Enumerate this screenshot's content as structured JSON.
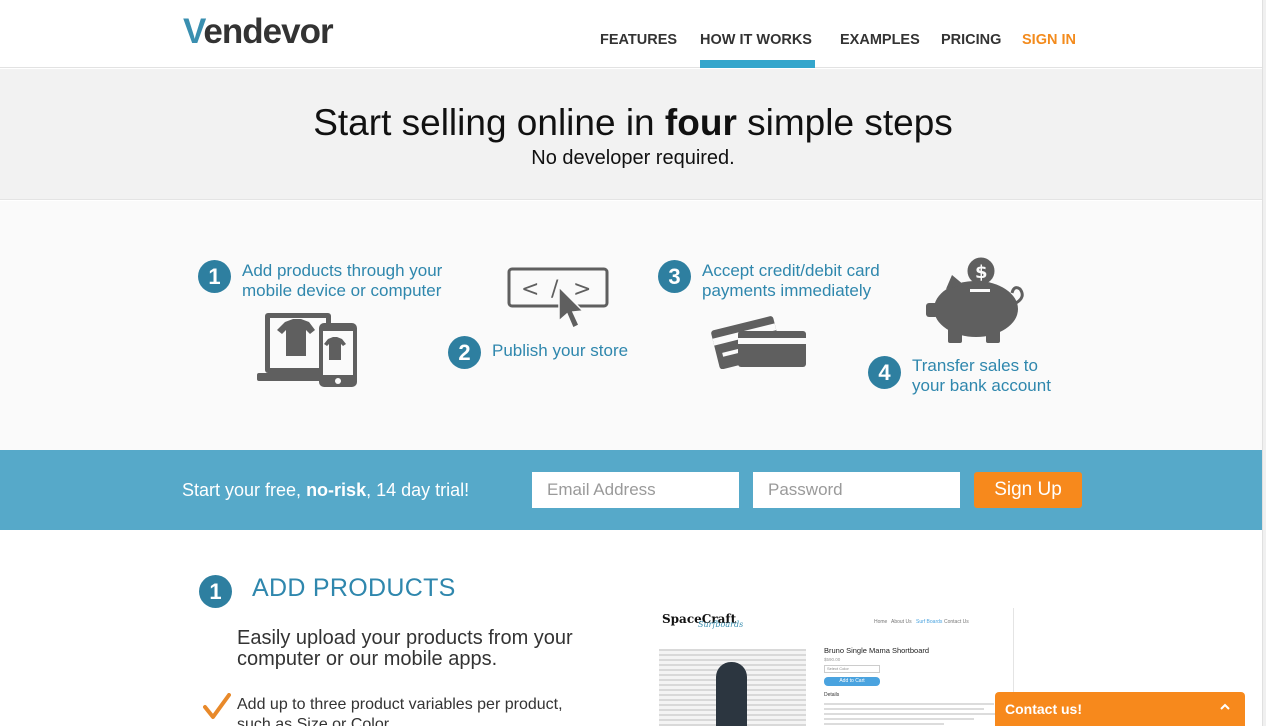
{
  "brand": {
    "logo_v": "V",
    "logo_rest": "endevor"
  },
  "nav": {
    "items": [
      {
        "label": "FEATURES"
      },
      {
        "label": "HOW IT WORKS"
      },
      {
        "label": "EXAMPLES"
      },
      {
        "label": "PRICING"
      },
      {
        "label": "SIGN IN"
      }
    ],
    "active": "HOW IT WORKS"
  },
  "hero": {
    "title_before": "Start selling online in ",
    "title_bold": "four",
    "title_after": " simple steps",
    "subtitle": "No developer required."
  },
  "steps": [
    {
      "number": "1",
      "line1": "Add products through your",
      "line2": "mobile device or computer",
      "icon": "devices-icon"
    },
    {
      "number": "2",
      "line1": "Publish your store",
      "line2": "",
      "icon": "code-cursor-icon"
    },
    {
      "number": "3",
      "line1": "Accept credit/debit card",
      "line2": "payments immediately",
      "icon": "credit-cards-icon"
    },
    {
      "number": "4",
      "line1": "Transfer sales to",
      "line2": "your bank account",
      "icon": "piggy-bank-icon"
    }
  ],
  "signup": {
    "text_before": "Start your free, ",
    "text_bold": "no-risk",
    "text_after": ", 14 day trial!",
    "email_placeholder": "Email Address",
    "password_placeholder": "Password",
    "button_label": "Sign Up"
  },
  "add_products": {
    "number": "1",
    "title": "ADD PRODUCTS",
    "lead": "Easily upload your products from your computer or our mobile apps.",
    "bullet": "Add up to three product variables per product, such as Size or Color."
  },
  "preview": {
    "logo": "SpaceCraft",
    "logo_sub": "Surfboards",
    "nav": [
      "Home",
      "About Us",
      "Surf Boards",
      "Contact Us"
    ],
    "product_title": "Bruno Single Mama Shortboard",
    "price": "$590.00",
    "select": "Select Color",
    "cart": "Add to Cart",
    "details": "Details"
  },
  "contact": {
    "label": "Contact us!"
  },
  "colors": {
    "accent_blue": "#34a6cc",
    "step_blue": "#2e7fa0",
    "orange": "#f7891c",
    "band": "#56a9c9"
  }
}
